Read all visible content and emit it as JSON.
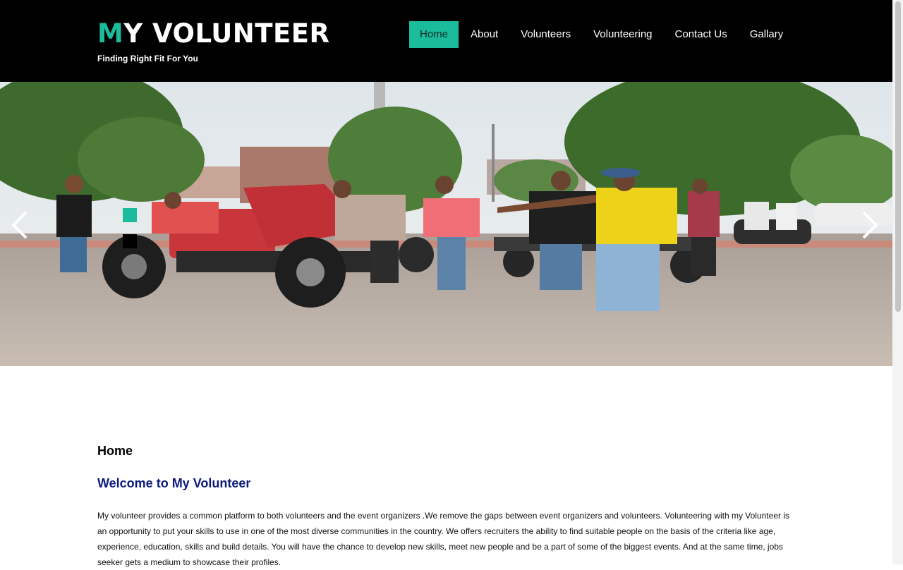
{
  "header": {
    "logo_first": "M",
    "logo_rest": "Y VOLUNTEER",
    "tagline": "Finding Right Fit For You",
    "nav": [
      {
        "label": "Home",
        "active": true
      },
      {
        "label": "About",
        "active": false
      },
      {
        "label": "Volunteers",
        "active": false
      },
      {
        "label": "Volunteering",
        "active": false
      },
      {
        "label": "Contact Us",
        "active": false
      },
      {
        "label": "Gallary",
        "active": false
      }
    ]
  },
  "carousel": {
    "prev_icon": "chevron-left-icon",
    "next_icon": "chevron-right-icon",
    "indicators": 2,
    "active_indicator": 1
  },
  "main": {
    "heading": "Home",
    "welcome": "Welcome to My Volunteer",
    "intro": "My volunteer provides a common platform to both volunteers and the event organizers .We remove the gaps between event organizers and volunteers. Volunteering with my Volunteer is an opportunity to put your skills to use in one of the most diverse communities in the country. We offers recruiters the ability to find suitable people on the basis of the criteria like age, experience, education, skills and build details. You will have the chance to develop new skills, meet new people and be a part of some of the biggest events. And at the same time, jobs seeker gets a medium to showcase their profiles."
  },
  "colors": {
    "accent": "#1abc9c",
    "header_bg": "#000000",
    "welcome_text": "#0c1a7a"
  }
}
